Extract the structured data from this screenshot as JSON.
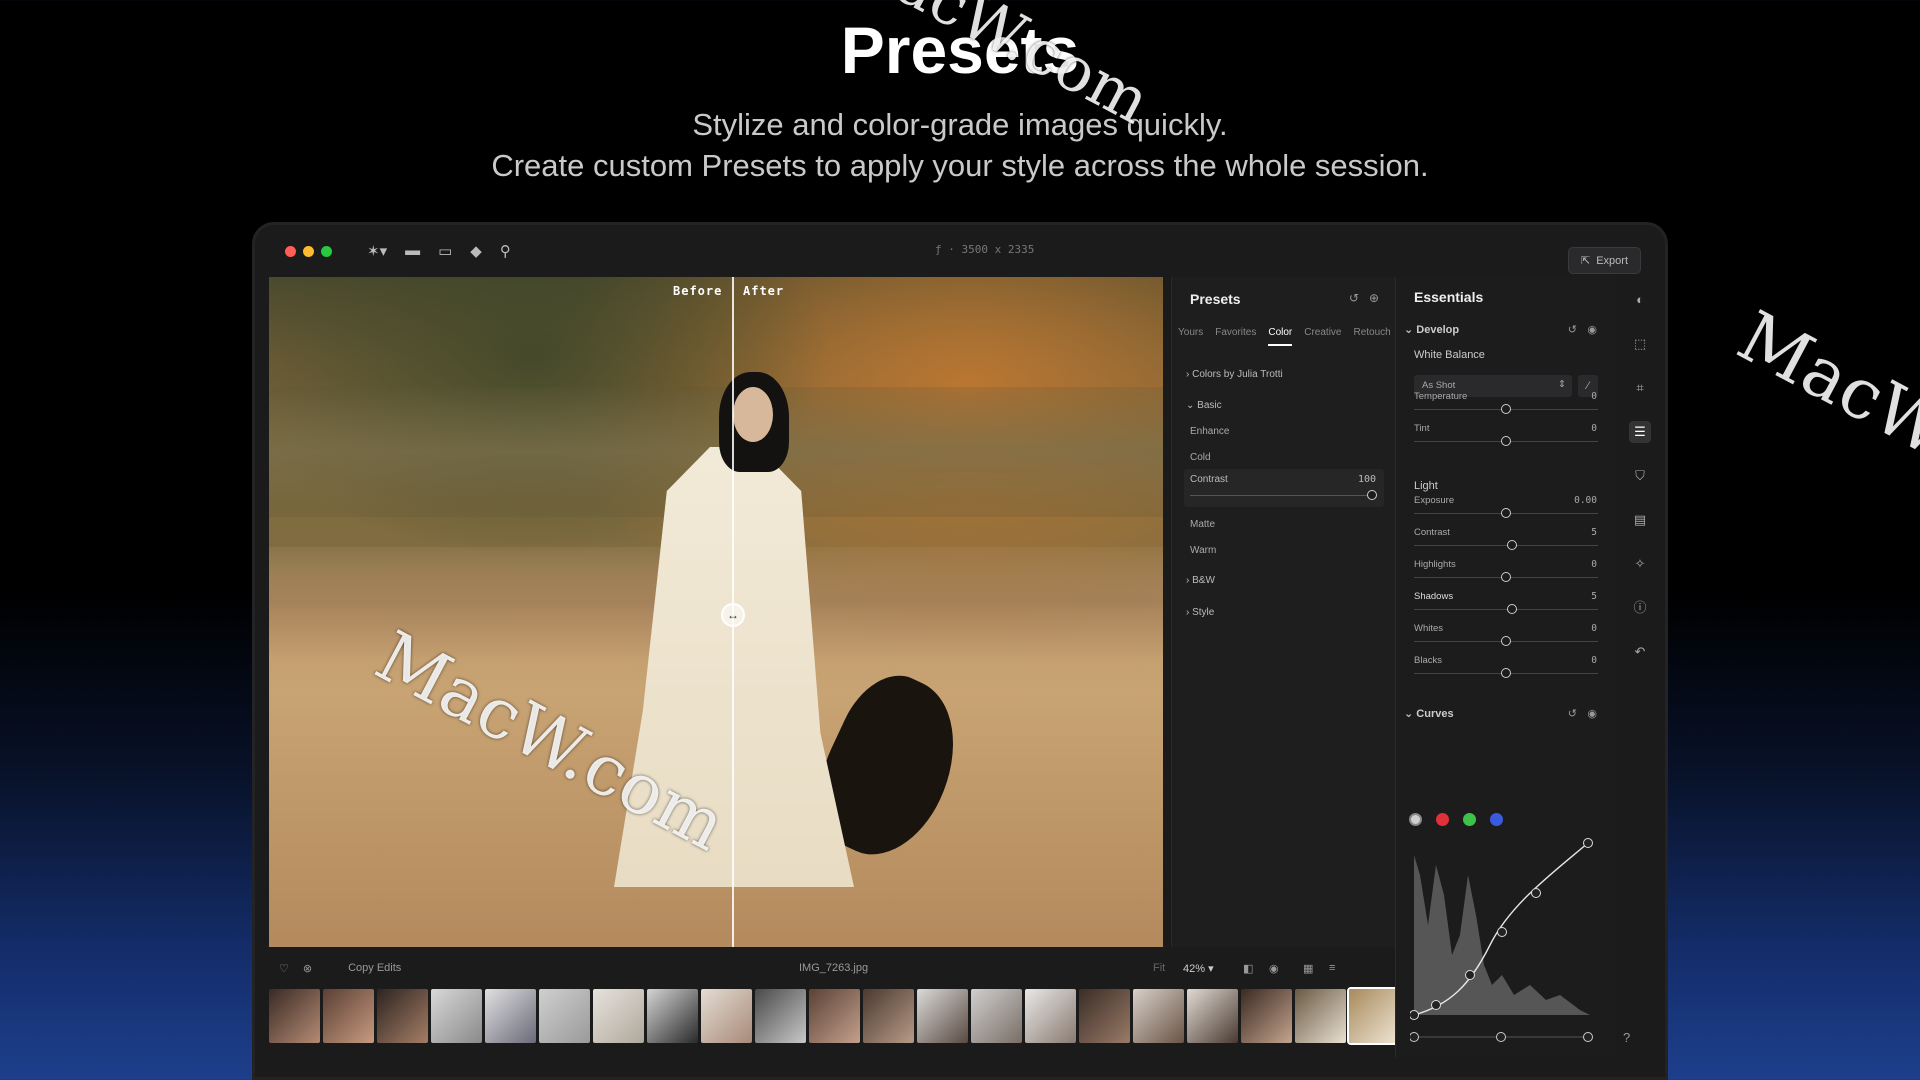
{
  "hero": {
    "title": "Presets",
    "line1": "Stylize and color-grade images quickly.",
    "line2": "Create custom Presets to apply your style across the whole session."
  },
  "watermark": "MacW.com",
  "titlebar": {
    "dimensions": "3500 x 2335",
    "export_label": "Export"
  },
  "viewer": {
    "before_label": "Before",
    "after_label": "After",
    "filename": "IMG_7263.jpg",
    "copy_edits_label": "Copy Edits",
    "fit_label": "Fit",
    "zoom": "42%"
  },
  "presets": {
    "title": "Presets",
    "tabs": [
      "Yours",
      "Favorites",
      "Color",
      "Creative",
      "Retouch"
    ],
    "active_tab": "Color",
    "groups": {
      "colors_by": "Colors by Julia Trotti",
      "basic": "Basic",
      "enhance": "Enhance",
      "cold": "Cold",
      "contrast": "Contrast",
      "contrast_value": "100",
      "matte": "Matte",
      "warm": "Warm",
      "bw": "B&W",
      "style": "Style"
    },
    "contrast_level": 1.0
  },
  "essentials": {
    "title": "Essentials",
    "develop": "Develop",
    "white_balance": "White Balance",
    "wb_mode": "As Shot",
    "light": "Light",
    "curves": "Curves",
    "sliders": {
      "temperature": {
        "label": "Temperature",
        "value": "0",
        "level": 0.5
      },
      "tint": {
        "label": "Tint",
        "value": "0",
        "level": 0.5
      },
      "exposure": {
        "label": "Exposure",
        "value": "0.00",
        "level": 0.5
      },
      "contrast": {
        "label": "Contrast",
        "value": "5",
        "level": 0.53
      },
      "highlights": {
        "label": "Highlights",
        "value": "0",
        "level": 0.5
      },
      "shadows": {
        "label": "Shadows",
        "value": "5",
        "level": 0.53
      },
      "whites": {
        "label": "Whites",
        "value": "0",
        "level": 0.5
      },
      "blacks": {
        "label": "Blacks",
        "value": "0",
        "level": 0.5
      }
    },
    "curve_channels": [
      "#cfcfcf",
      "#e0313a",
      "#3ec24a",
      "#3a5be0"
    ]
  },
  "colors": {
    "traffic_red": "#ff5f57",
    "traffic_yellow": "#febc2e",
    "traffic_green": "#28c840"
  }
}
